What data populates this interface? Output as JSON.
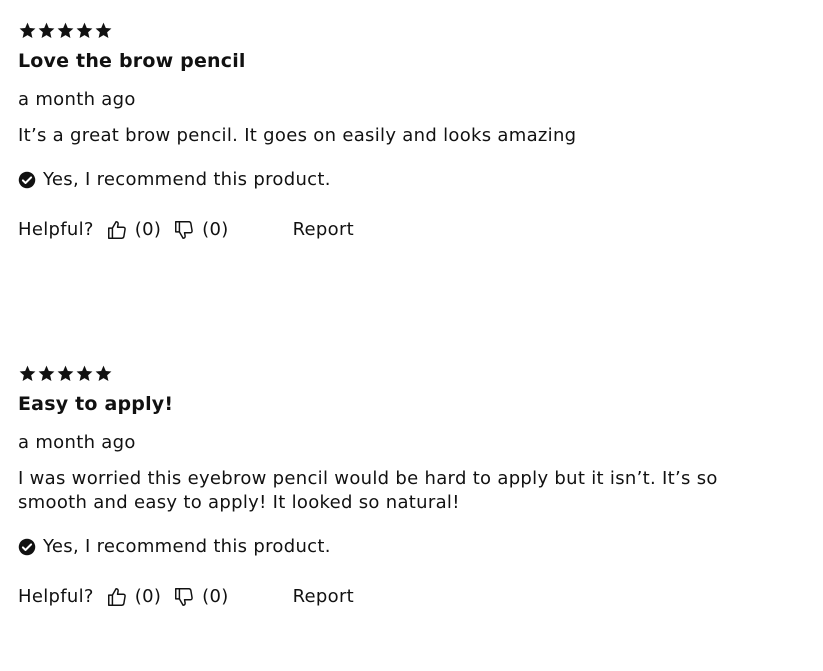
{
  "colors": {
    "text": "#111111",
    "background": "#ffffff",
    "star": "#111111"
  },
  "reviews": [
    {
      "rating": 5,
      "title": "Love the brow pencil",
      "date": "a month ago",
      "body": "It’s a great brow pencil. It goes on easily and looks amazing",
      "recommend_text": "Yes, I recommend this product.",
      "helpful_label": "Helpful?",
      "thumbs_up_count": "(0)",
      "thumbs_down_count": "(0)",
      "report_label": "Report"
    },
    {
      "rating": 5,
      "title": "Easy to apply!",
      "date": "a month ago",
      "body": "I was worried this eyebrow pencil would be hard to apply but it isn’t. It’s so smooth and easy to apply! It looked so natural!",
      "recommend_text": "Yes, I recommend this product.",
      "helpful_label": "Helpful?",
      "thumbs_up_count": "(0)",
      "thumbs_down_count": "(0)",
      "report_label": "Report"
    }
  ]
}
